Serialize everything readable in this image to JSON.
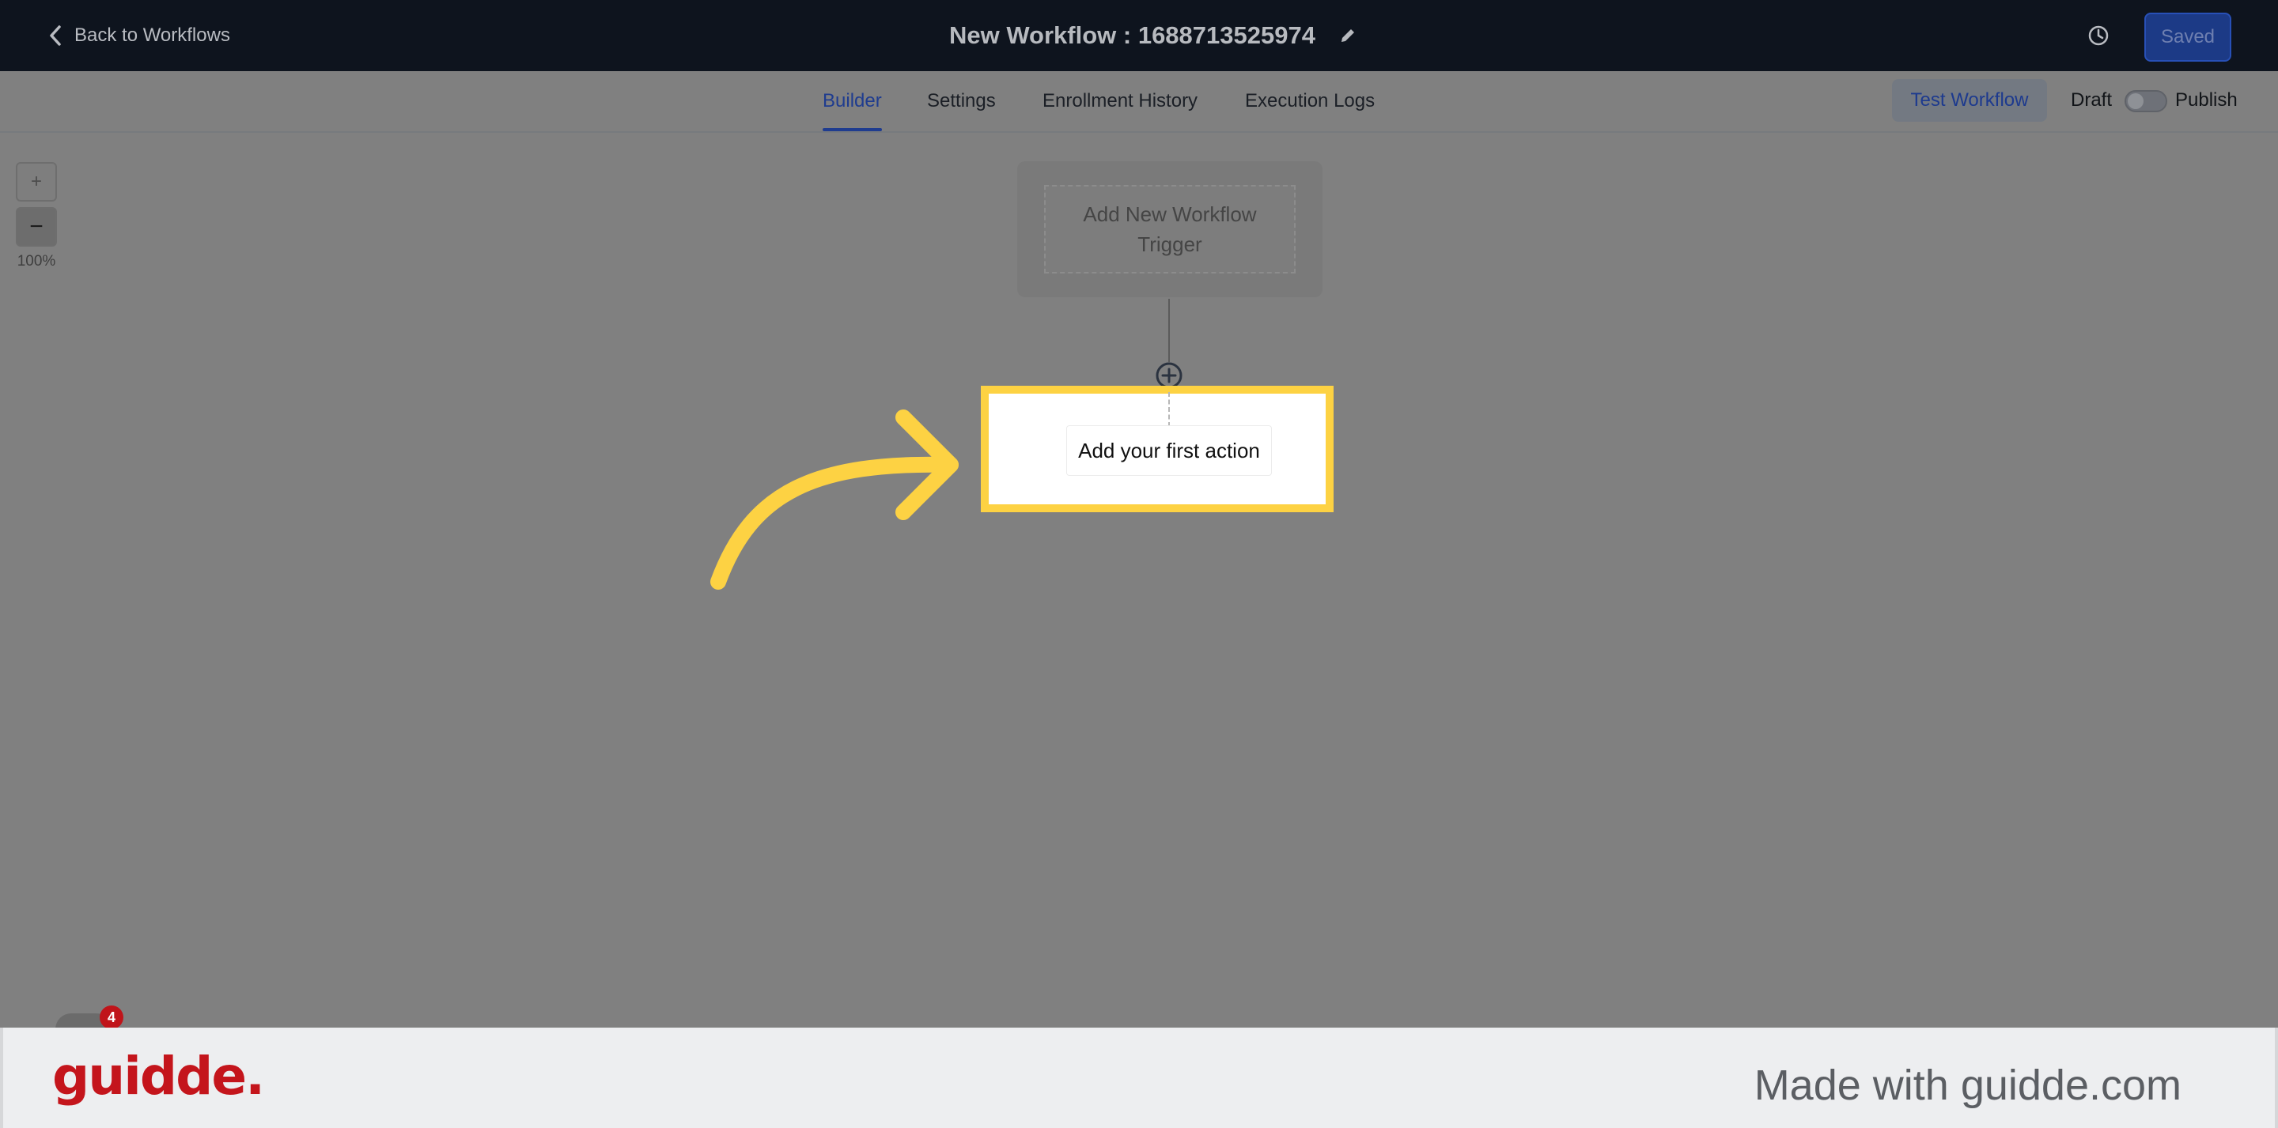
{
  "header": {
    "back_label": "Back to Workflows",
    "workflow_title": "New Workflow : 1688713525974",
    "saved_label": "Saved"
  },
  "tabs": [
    {
      "label": "Builder",
      "active": true
    },
    {
      "label": "Settings",
      "active": false
    },
    {
      "label": "Enrollment History",
      "active": false
    },
    {
      "label": "Execution Logs",
      "active": false
    }
  ],
  "actions": {
    "test_label": "Test Workflow",
    "draft_label": "Draft",
    "publish_label": "Publish",
    "published": false
  },
  "zoom": {
    "in_label": "+",
    "out_label": "−",
    "level": "100%"
  },
  "canvas": {
    "trigger_line1": "Add New Workflow",
    "trigger_line2": "Trigger",
    "first_action_label": "Add your first action"
  },
  "chat": {
    "badge_count": "4"
  },
  "footer": {
    "logo_text": "guidde.",
    "made_with": "Made with guidde.com"
  },
  "colors": {
    "header_bg": "#0e141e",
    "accent_blue": "#1f3c8f",
    "highlight_yellow": "#fdd243",
    "brand_red": "#c4151c"
  }
}
